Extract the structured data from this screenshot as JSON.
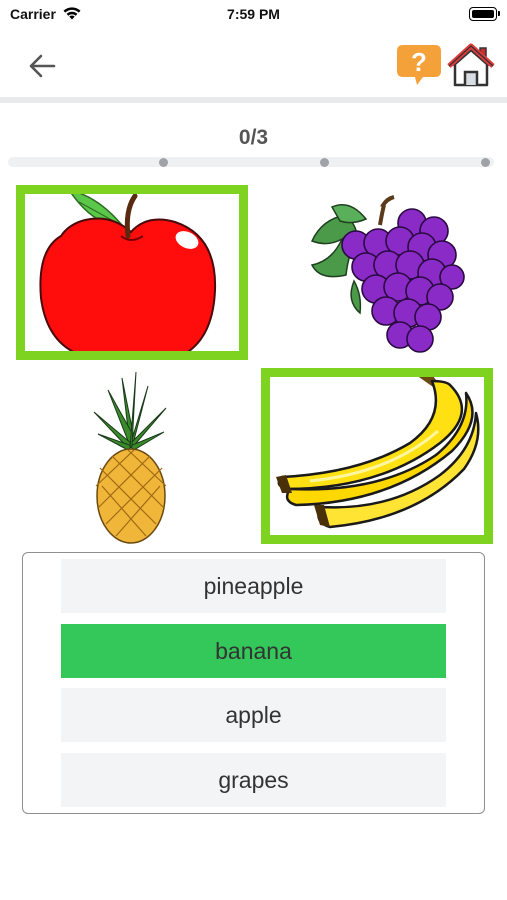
{
  "status_bar": {
    "carrier": "Carrier",
    "time": "7:59 PM",
    "icons": [
      "wifi-icon",
      "battery-icon"
    ]
  },
  "nav": {
    "back_icon": "arrow-left-icon",
    "help_icon": "question-bubble-icon",
    "home_icon": "home-icon"
  },
  "progress": {
    "label": "0/3",
    "current": 0,
    "total": 3
  },
  "tiles": [
    {
      "name": "apple",
      "selected": true
    },
    {
      "name": "grapes",
      "selected": false
    },
    {
      "name": "pineapple",
      "selected": false
    },
    {
      "name": "banana",
      "selected": true
    }
  ],
  "answers": [
    {
      "label": "pineapple",
      "selected": false
    },
    {
      "label": "banana",
      "selected": true
    },
    {
      "label": "apple",
      "selected": false
    },
    {
      "label": "grapes",
      "selected": false
    }
  ],
  "colors": {
    "tile_border_selected": "#7ed321",
    "answer_selected": "#34c759",
    "help_orange": "#f5a13a",
    "home_red": "#e23b3b"
  }
}
